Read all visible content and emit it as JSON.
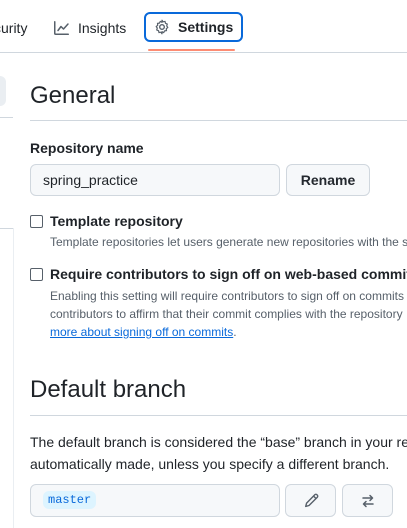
{
  "nav": {
    "tabs": [
      {
        "label": "curity",
        "icon": ""
      },
      {
        "label": "Insights",
        "icon": "graph-icon"
      },
      {
        "label": "Settings",
        "icon": "gear-icon",
        "selected": true
      }
    ]
  },
  "general": {
    "heading": "General",
    "repo_name_label": "Repository name",
    "repo_name_value": "spring_practice",
    "rename_label": "Rename",
    "template": {
      "title": "Template repository",
      "desc": "Template repositories let users generate new repositories with the sa",
      "checked": false
    },
    "signoff": {
      "title": "Require contributors to sign off on web-based commits",
      "desc_line1": "Enabling this setting will require contributors to sign off on commits",
      "desc_line2": "contributors to affirm that their commit complies with the repository",
      "link_text": "more about signing off on commits",
      "link_suffix": ".",
      "checked": false
    }
  },
  "default_branch": {
    "heading": "Default branch",
    "desc_line1": "The default branch is considered the “base” branch in your re",
    "desc_line2": "automatically made, unless you specify a different branch.",
    "branch": "master",
    "edit_icon": "pencil-icon",
    "switch_icon": "arrow-switch-icon"
  },
  "colors": {
    "accent": "#0969da",
    "underline": "#fd8c73",
    "border": "#d0d7de",
    "muted": "#57606a"
  }
}
